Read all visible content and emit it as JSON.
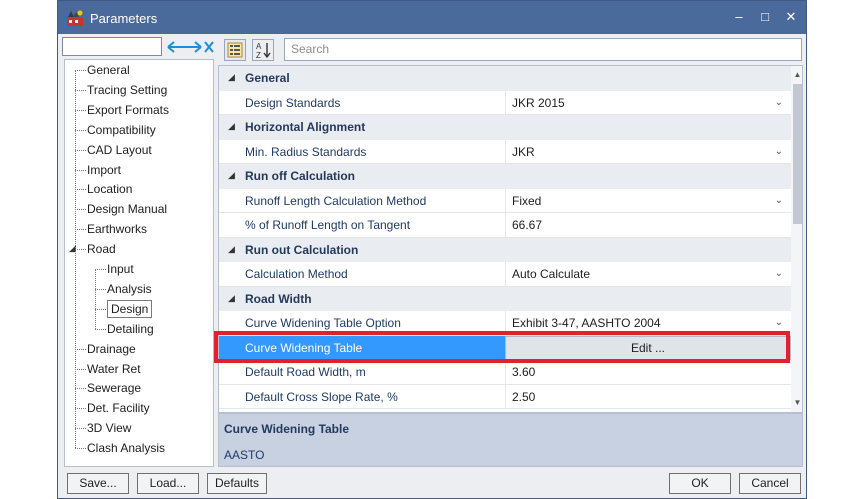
{
  "window": {
    "title": "Parameters",
    "minimize": "–",
    "maximize": "□",
    "close": "✕"
  },
  "tree": {
    "items": [
      {
        "label": "General",
        "level": 0
      },
      {
        "label": "Tracing Setting",
        "level": 0
      },
      {
        "label": "Export Formats",
        "level": 0
      },
      {
        "label": "Compatibility",
        "level": 0
      },
      {
        "label": "CAD Layout",
        "level": 0
      },
      {
        "label": "Import",
        "level": 0
      },
      {
        "label": "Location",
        "level": 0
      },
      {
        "label": "Design Manual",
        "level": 0
      },
      {
        "label": "Earthworks",
        "level": 0
      },
      {
        "label": "Road",
        "level": 0
      },
      {
        "label": "Input",
        "level": 1
      },
      {
        "label": "Analysis",
        "level": 1
      },
      {
        "label": "Design",
        "level": 1,
        "selected": true
      },
      {
        "label": "Detailing",
        "level": 1
      },
      {
        "label": "Drainage",
        "level": 0
      },
      {
        "label": "Water Ret",
        "level": 0
      },
      {
        "label": "Sewerage",
        "level": 0
      },
      {
        "label": "Det. Facility",
        "level": 0
      },
      {
        "label": "3D View",
        "level": 0
      },
      {
        "label": "Clash Analysis",
        "level": 0
      }
    ]
  },
  "toolbar": {
    "search_placeholder": "Search",
    "categorized_icon": "categorized-icon",
    "alphabetical_icon": "sort-az-icon"
  },
  "grid": {
    "rows": [
      {
        "kind": "category",
        "name": "General"
      },
      {
        "kind": "property",
        "name": "Design Standards",
        "value": "JKR 2015",
        "dropdown": true
      },
      {
        "kind": "category",
        "name": "Horizontal Alignment"
      },
      {
        "kind": "property",
        "name": "Min. Radius Standards",
        "value": "JKR",
        "dropdown": true
      },
      {
        "kind": "category",
        "name": "Run off Calculation"
      },
      {
        "kind": "property",
        "name": "Runoff Length Calculation Method",
        "value": "Fixed",
        "dropdown": true
      },
      {
        "kind": "property",
        "name": "% of Runoff Length on Tangent",
        "value": "66.67",
        "dropdown": false
      },
      {
        "kind": "category",
        "name": "Run out Calculation"
      },
      {
        "kind": "property",
        "name": "Calculation Method",
        "value": "Auto Calculate",
        "dropdown": true
      },
      {
        "kind": "category",
        "name": "Road Width"
      },
      {
        "kind": "property",
        "name": "Curve Widening Table Option",
        "value": "Exhibit 3-47, AASHTO 2004",
        "dropdown": true
      },
      {
        "kind": "button",
        "name": "Curve Widening Table",
        "value": "Edit ...",
        "selected": true
      },
      {
        "kind": "property",
        "name": "Default Road Width, m",
        "value": "3.60",
        "dropdown": false
      },
      {
        "kind": "property",
        "name": "Default Cross Slope Rate, %",
        "value": "2.50",
        "dropdown": false
      }
    ]
  },
  "description": {
    "title": "Curve Widening Table",
    "text": "AASTO"
  },
  "footer": {
    "save": "Save...",
    "load": "Load...",
    "defaults": "Defaults",
    "ok": "OK",
    "cancel": "Cancel"
  },
  "colors": {
    "titlebar": "#4a6a9c",
    "selection": "#3399ff",
    "highlight": "#e5202e"
  }
}
